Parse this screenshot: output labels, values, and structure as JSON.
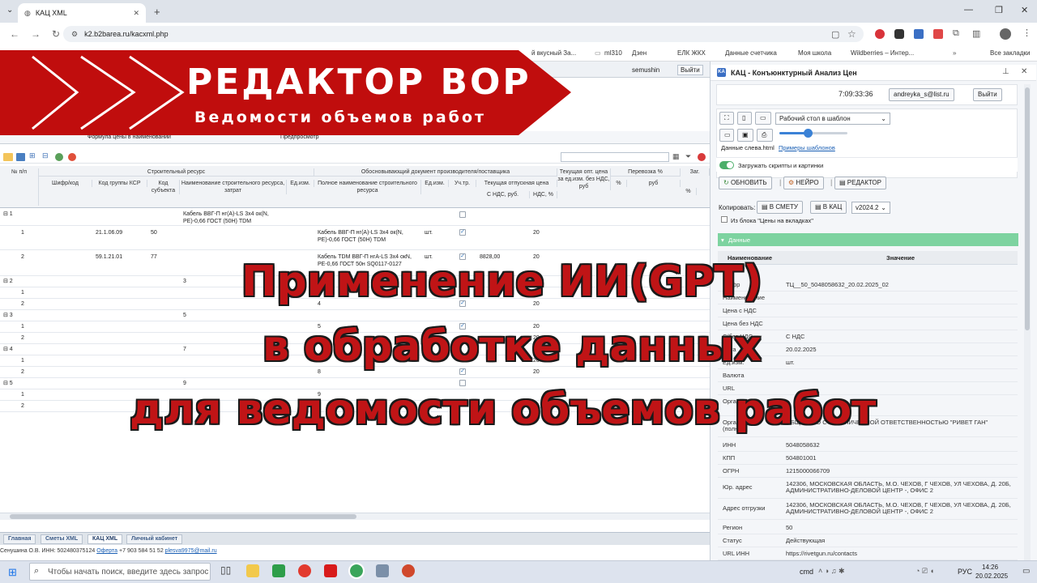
{
  "browser": {
    "tab_title": "КАЦ XML",
    "url": "k2.b2barea.ru/kacxml.php",
    "bookmarks": [
      "й вкусный За...",
      "ml310",
      "Дзен",
      "ЕЛК ЖКХ",
      "Данные счетчика",
      "Моя школа",
      "Wildberries – Интер...",
      "Все закладки"
    ]
  },
  "left": {
    "user": "semushin",
    "logout": "Выйти",
    "subtab_formula": "Формула цены в наименовании",
    "subtab_preview": "Предпросмотр",
    "headers": {
      "num": "№ п/п",
      "group1": "Строительный ресурс",
      "cipher": "Шифр/код",
      "ksr": "Код группы КСР",
      "subj": "Код субъекта",
      "resname": "Наименование строительного ресурса, затрат",
      "unit": "Ед.изм.",
      "group2": "Обосновывающий документ производителя/поставщика",
      "fullname": "Полное наименование строительного ресурса",
      "unit2": "Ед.изм.",
      "uch": "Уч.тр.",
      "curprice": "Текущая отпускная цена",
      "withvat": "С НДС, руб.",
      "vat": "НДС, %",
      "optprice": "Текущая опт. цена за ед.изм. без НДС, руб",
      "transport": "Перевозка %",
      "pct": "%",
      "rub": "руб",
      "zag": "Заг.",
      "pct2": "%"
    },
    "rows": [
      {
        "n": "⊟ 1",
        "name": "Кабель ВВГ-П нг(А)-LS 3х4 ок(N, PE)-0,66 ГОСТ (50Н) TDM"
      },
      {
        "n": "1",
        "ksr": "21.1.06.09",
        "subj": "50",
        "full": "Кабель ВВГ-П нг(А)-LS 3х4 ок(N, PE)-0,66 ГОСТ (50Н) TDM",
        "unit": "шт.",
        "price": "",
        "vat": "20"
      },
      {
        "n": "2",
        "ksr": "59.1.21.01",
        "subj": "77",
        "full": "Кабель TDM ВВГ-П нгА-LS 3х4 окN, PE-0,66 ГОСТ 50н SQ0117-0127",
        "unit": "шт.",
        "price": "8828,00",
        "vat": "20"
      },
      {
        "n": "⊟ 2",
        "name": "3"
      },
      {
        "n": "1"
      },
      {
        "n": "2",
        "full": "4",
        "vat": "20"
      },
      {
        "n": "⊟ 3",
        "name": "5"
      },
      {
        "n": "1",
        "full": "5",
        "vat": "20"
      },
      {
        "n": "2",
        "vat": "20"
      },
      {
        "n": "⊟ 4",
        "name": "7"
      },
      {
        "n": "1",
        "vat": "20"
      },
      {
        "n": "2",
        "full": "8",
        "vat": "20"
      },
      {
        "n": "⊟ 5",
        "name": "9"
      },
      {
        "n": "1",
        "full": "9"
      },
      {
        "n": "2"
      }
    ],
    "bottom_tabs": [
      "Главная",
      "Сметы XML",
      "КАЦ XML",
      "Личный кабинет"
    ],
    "status": "Сенушина О.В. ИНН: 502480375124",
    "status_link": "Оферта",
    "status_phone": "+7 903 584 51 52",
    "status_email": "plesva9975@mail.ru"
  },
  "banner": {
    "title": "РЕДАКТОР ВОР",
    "subtitle": "Ведомости объемов работ",
    "line1": "Применение ИИ(GPT)",
    "line2": "в обработке данных",
    "line3": "для ведомости объемов работ"
  },
  "right": {
    "title": "КАЦ - Конъюнктурный Анализ Цен",
    "time": "7:09:33:36",
    "email": "andreyka_s@list.ru",
    "logout": "Выйти",
    "template_select": "Рабочий стол в шаблон",
    "data_left": "Данные слева.html",
    "examples": "Примеры шаблонов",
    "load_scripts": "Загружать скрипты и картинки",
    "btn_update": "ОБНОВИТЬ",
    "btn_neuro": "НЕЙРО",
    "btn_editor": "РЕДАКТОР",
    "copy_label": "Копировать:",
    "btn_smeta": "В СМЕТУ",
    "btn_kac": "В КАЦ",
    "version": "v2024.2",
    "from_block": "Из блока \"Цены на вкладках\"",
    "section": "Данные",
    "col_name": "Наименование",
    "col_value": "Значение",
    "fields": [
      {
        "n": "Шифр",
        "v": "ТЦ__50_5048058632_20.02.2025_02"
      },
      {
        "n": "Наименование",
        "v": ""
      },
      {
        "n": "Цена с НДС",
        "v": ""
      },
      {
        "n": "Цена без НДС",
        "v": ""
      },
      {
        "n": "С/без НДС",
        "v": "С НДС"
      },
      {
        "n": "Дата",
        "v": "20.02.2025"
      },
      {
        "n": "Ед.изм.",
        "v": "шт."
      },
      {
        "n": "Валюта",
        "v": ""
      },
      {
        "n": "URL",
        "v": ""
      },
      {
        "n": "Организация",
        "v": ""
      },
      {
        "n": "Организация (полное)",
        "v": "ОБЩЕСТВО С ОГРАНИЧЕННОЙ ОТВЕТСТВЕННОСТЬЮ \"РИВЕТ ГАН\""
      },
      {
        "n": "ИНН",
        "v": "5048058632"
      },
      {
        "n": "КПП",
        "v": "504801001"
      },
      {
        "n": "ОГРН",
        "v": "1215000066709"
      },
      {
        "n": "Юр. адрес",
        "v": "142306, МОСКОВСКАЯ ОБЛАСТЬ, М.О. ЧЕХОВ, Г ЧЕХОВ, УЛ ЧЕХОВА, Д. 20Б, АДМИНИСТРАТИВНО-ДЕЛОВОЙ ЦЕНТР -, ОФИС 2"
      },
      {
        "n": "Адрес отгрузки",
        "v": "142306, МОСКОВСКАЯ ОБЛАСТЬ, М.О. ЧЕХОВ, Г ЧЕХОВ, УЛ ЧЕХОВА, Д. 20Б, АДМИНИСТРАТИВНО-ДЕЛОВОЙ ЦЕНТР -, ОФИС 2"
      },
      {
        "n": "Регион",
        "v": "50"
      },
      {
        "n": "Статус",
        "v": "Действующая"
      },
      {
        "n": "URL ИНН",
        "v": "https://rivetgun.ru/contacts"
      }
    ]
  },
  "taskbar": {
    "search": "Чтобы начать поиск, введите здесь запрос",
    "cmd": "cmd",
    "lang": "РУС",
    "time": "14:26",
    "date": "20.02.2025"
  },
  "colors": {
    "banner_red": "#c00d0d",
    "accent_green": "#7dd3a0",
    "link_blue": "#1a5fb4"
  }
}
